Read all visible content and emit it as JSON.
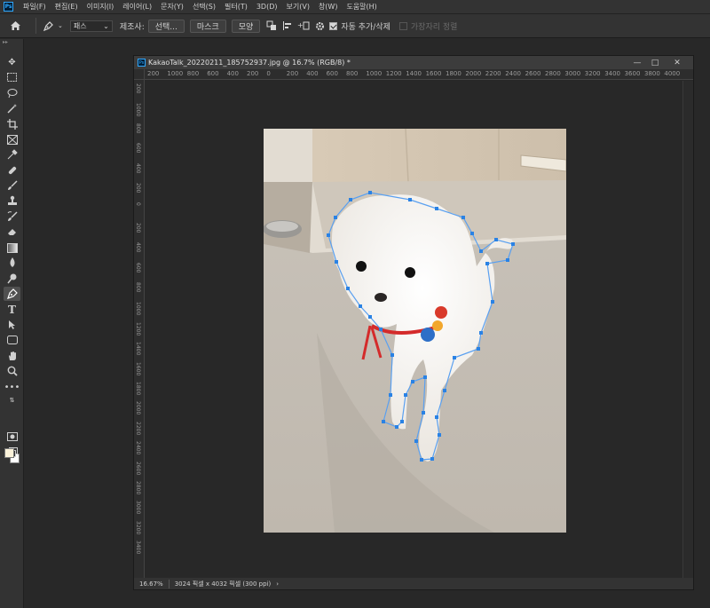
{
  "app": {
    "logo": "Ps"
  },
  "menu": [
    "파일(F)",
    "편집(E)",
    "이미지(I)",
    "레이어(L)",
    "문자(Y)",
    "선택(S)",
    "필터(T)",
    "3D(D)",
    "보기(V)",
    "창(W)",
    "도움말(H)"
  ],
  "options": {
    "mode_value": "패스",
    "make_label": "제조사:",
    "selection_button": "선택...",
    "mask_button": "마스크",
    "shape_button": "모양",
    "auto_add_label": "자동 추가/삭제",
    "auto_add_checked": true,
    "align_edges_label": "가장자리 정렬",
    "align_edges_checked": false
  },
  "document": {
    "title": "KakaoTalk_20220211_185752937.jpg @ 16.7% (RGB/8) *",
    "minimize": "—",
    "restore": "□",
    "close": "✕"
  },
  "ruler": {
    "horizontal": [
      "200",
      "1000",
      "800",
      "600",
      "400",
      "200",
      "0",
      "200",
      "400",
      "600",
      "800",
      "1000",
      "1200",
      "1400",
      "1600",
      "1800",
      "2000",
      "2200",
      "2400",
      "2600",
      "2800",
      "3000",
      "3200",
      "3400",
      "3600",
      "3800",
      "4000"
    ]
  },
  "status": {
    "zoom": "16.67%",
    "doc_info": "3024 픽셀 x 4032 픽셀 (300 ppi)",
    "arrow": "›"
  },
  "colors": {
    "foreground": "#fbf2da",
    "background": "#ffffff",
    "path_handle": "#2a82e4",
    "path_line": "#5aa0f0"
  },
  "icons": {
    "home": "home-icon",
    "pen": "pen-tool-icon",
    "gear": "gear-icon"
  }
}
